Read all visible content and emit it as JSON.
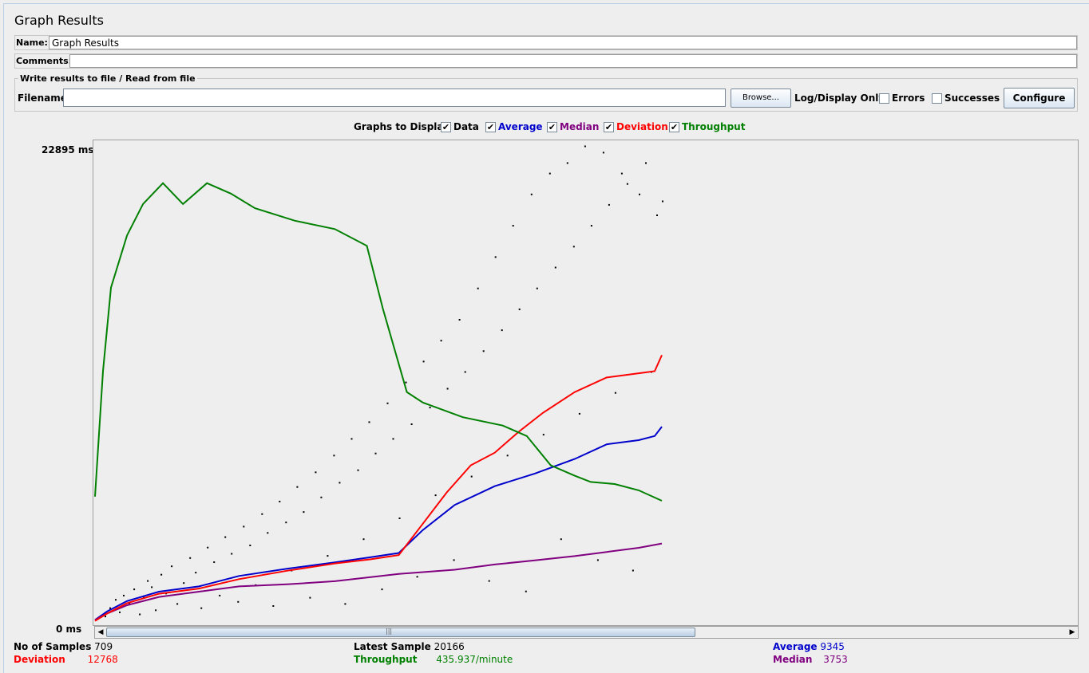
{
  "window": {
    "title": "Graph Results"
  },
  "name_row": {
    "label": "Name:",
    "value": "Graph Results"
  },
  "comments_row": {
    "label": "Comments:",
    "value": ""
  },
  "file_group": {
    "legend": "Write results to file / Read from file",
    "filename_label": "Filename",
    "filename_value": "",
    "browse_label": "Browse...",
    "log_display_label": "Log/Display Only:",
    "errors_label": "Errors",
    "successes_label": "Successes",
    "errors_checked": false,
    "successes_checked": false,
    "configure_label": "Configure"
  },
  "graphs_to_display": {
    "label": "Graphs to Display",
    "options": [
      {
        "label": "Data",
        "checked": true,
        "color": "#000000"
      },
      {
        "label": "Average",
        "checked": true,
        "color": "#0000cc"
      },
      {
        "label": "Median",
        "checked": true,
        "color": "#800080"
      },
      {
        "label": "Deviation",
        "checked": true,
        "color": "#ff0000"
      },
      {
        "label": "Throughput",
        "checked": true,
        "color": "#008000"
      }
    ]
  },
  "chart_data": {
    "type": "line",
    "y_max_label": "22895  ms",
    "y_min_label": "0  ms",
    "ylim": [
      0,
      22895
    ],
    "x_samples": 709,
    "series": [
      {
        "name": "Average",
        "color": "#0000cc",
        "points": [
          [
            0,
            100
          ],
          [
            15,
            500
          ],
          [
            40,
            1000
          ],
          [
            80,
            1450
          ],
          [
            130,
            1700
          ],
          [
            180,
            2200
          ],
          [
            240,
            2550
          ],
          [
            300,
            2850
          ],
          [
            345,
            3100
          ],
          [
            380,
            3300
          ],
          [
            410,
            4400
          ],
          [
            450,
            5600
          ],
          [
            500,
            6500
          ],
          [
            550,
            7100
          ],
          [
            600,
            7800
          ],
          [
            640,
            8500
          ],
          [
            680,
            8700
          ],
          [
            700,
            8900
          ],
          [
            709,
            9345
          ]
        ]
      },
      {
        "name": "Median",
        "color": "#800080",
        "points": [
          [
            0,
            100
          ],
          [
            15,
            400
          ],
          [
            40,
            800
          ],
          [
            80,
            1200
          ],
          [
            130,
            1450
          ],
          [
            180,
            1700
          ],
          [
            240,
            1800
          ],
          [
            300,
            1950
          ],
          [
            380,
            2300
          ],
          [
            450,
            2500
          ],
          [
            500,
            2750
          ],
          [
            550,
            2950
          ],
          [
            600,
            3150
          ],
          [
            640,
            3350
          ],
          [
            680,
            3550
          ],
          [
            709,
            3753
          ]
        ]
      },
      {
        "name": "Deviation",
        "color": "#ff0000",
        "points": [
          [
            0,
            50
          ],
          [
            15,
            400
          ],
          [
            40,
            900
          ],
          [
            80,
            1350
          ],
          [
            130,
            1600
          ],
          [
            180,
            2050
          ],
          [
            240,
            2450
          ],
          [
            300,
            2800
          ],
          [
            345,
            3000
          ],
          [
            380,
            3200
          ],
          [
            410,
            4700
          ],
          [
            440,
            6200
          ],
          [
            470,
            7500
          ],
          [
            500,
            8100
          ],
          [
            530,
            9100
          ],
          [
            560,
            10000
          ],
          [
            600,
            11000
          ],
          [
            640,
            11700
          ],
          [
            680,
            11900
          ],
          [
            700,
            12000
          ],
          [
            709,
            12768
          ]
        ]
      },
      {
        "name": "Throughput",
        "color": "#008000",
        "points": [
          [
            0,
            6000
          ],
          [
            10,
            12000
          ],
          [
            20,
            16000
          ],
          [
            40,
            18500
          ],
          [
            60,
            20000
          ],
          [
            85,
            21000
          ],
          [
            110,
            20000
          ],
          [
            140,
            21000
          ],
          [
            170,
            20500
          ],
          [
            200,
            19800
          ],
          [
            250,
            19200
          ],
          [
            300,
            18800
          ],
          [
            340,
            18000
          ],
          [
            360,
            15000
          ],
          [
            390,
            11000
          ],
          [
            410,
            10500
          ],
          [
            460,
            9800
          ],
          [
            510,
            9400
          ],
          [
            540,
            8900
          ],
          [
            570,
            7500
          ],
          [
            600,
            7000
          ],
          [
            620,
            6700
          ],
          [
            650,
            6600
          ],
          [
            680,
            6300
          ],
          [
            709,
            5800
          ]
        ]
      }
    ],
    "data_points": [
      [
        12,
        300
      ],
      [
        18,
        700
      ],
      [
        25,
        1100
      ],
      [
        30,
        500
      ],
      [
        35,
        1300
      ],
      [
        42,
        900
      ],
      [
        48,
        1600
      ],
      [
        55,
        400
      ],
      [
        60,
        1200
      ],
      [
        65,
        2000
      ],
      [
        70,
        1700
      ],
      [
        75,
        600
      ],
      [
        82,
        2300
      ],
      [
        88,
        1400
      ],
      [
        95,
        2700
      ],
      [
        102,
        900
      ],
      [
        110,
        1900
      ],
      [
        118,
        3100
      ],
      [
        125,
        2400
      ],
      [
        132,
        700
      ],
      [
        140,
        3600
      ],
      [
        148,
        2900
      ],
      [
        155,
        1300
      ],
      [
        162,
        4100
      ],
      [
        170,
        3300
      ],
      [
        178,
        1000
      ],
      [
        185,
        4600
      ],
      [
        193,
        3700
      ],
      [
        200,
        1800
      ],
      [
        208,
        5200
      ],
      [
        215,
        4300
      ],
      [
        222,
        800
      ],
      [
        230,
        5800
      ],
      [
        238,
        4800
      ],
      [
        245,
        2500
      ],
      [
        252,
        6500
      ],
      [
        260,
        5300
      ],
      [
        268,
        1200
      ],
      [
        275,
        7200
      ],
      [
        282,
        6000
      ],
      [
        290,
        3200
      ],
      [
        298,
        8000
      ],
      [
        305,
        6700
      ],
      [
        312,
        900
      ],
      [
        320,
        8800
      ],
      [
        328,
        7300
      ],
      [
        335,
        4000
      ],
      [
        342,
        9600
      ],
      [
        350,
        8100
      ],
      [
        358,
        1600
      ],
      [
        365,
        10500
      ],
      [
        372,
        8800
      ],
      [
        380,
        5000
      ],
      [
        388,
        11500
      ],
      [
        395,
        9500
      ],
      [
        402,
        2200
      ],
      [
        410,
        12500
      ],
      [
        418,
        10300
      ],
      [
        425,
        6100
      ],
      [
        432,
        13500
      ],
      [
        440,
        11200
      ],
      [
        448,
        3000
      ],
      [
        455,
        14500
      ],
      [
        462,
        12000
      ],
      [
        470,
        7000
      ],
      [
        478,
        16000
      ],
      [
        485,
        13000
      ],
      [
        492,
        2000
      ],
      [
        500,
        17500
      ],
      [
        508,
        14000
      ],
      [
        515,
        8000
      ],
      [
        522,
        19000
      ],
      [
        530,
        15000
      ],
      [
        538,
        1500
      ],
      [
        545,
        20500
      ],
      [
        552,
        16000
      ],
      [
        560,
        9000
      ],
      [
        568,
        21500
      ],
      [
        575,
        17000
      ],
      [
        582,
        4000
      ],
      [
        590,
        22000
      ],
      [
        598,
        18000
      ],
      [
        605,
        10000
      ],
      [
        612,
        22800
      ],
      [
        620,
        19000
      ],
      [
        628,
        3000
      ],
      [
        635,
        22500
      ],
      [
        642,
        20000
      ],
      [
        650,
        11000
      ],
      [
        658,
        21500
      ],
      [
        665,
        21000
      ],
      [
        672,
        2500
      ],
      [
        680,
        20500
      ],
      [
        688,
        22000
      ],
      [
        695,
        12000
      ],
      [
        702,
        19500
      ],
      [
        709,
        20166
      ]
    ]
  },
  "stats": {
    "samples_label": "No of Samples",
    "samples_value": "709",
    "latest_label": "Latest Sample",
    "latest_value": "20166",
    "average_label": "Average",
    "average_value": "9345",
    "deviation_label": "Deviation",
    "deviation_value": "12768",
    "throughput_label": "Throughput",
    "throughput_value": "435.937/minute",
    "median_label": "Median",
    "median_value": "3753"
  }
}
